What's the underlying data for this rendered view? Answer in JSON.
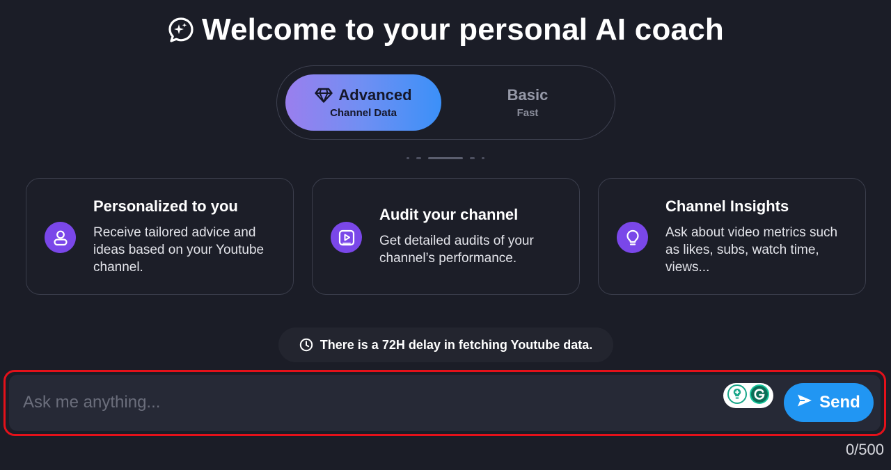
{
  "header": {
    "title": "Welcome to your personal AI coach",
    "title_icon": "chat-sparkle-icon"
  },
  "mode_toggle": {
    "advanced": {
      "label": "Advanced",
      "sublabel": "Channel Data",
      "icon": "diamond-icon",
      "selected": true
    },
    "basic": {
      "label": "Basic",
      "sublabel": "Fast",
      "selected": false
    }
  },
  "cards": [
    {
      "title": "Personalized to you",
      "text": "Receive tailored advice and ideas based on your Youtube channel.",
      "icon": "user-icon"
    },
    {
      "title": "Audit your channel",
      "text": "Get detailed audits of your channel’s performance.",
      "icon": "video-play-icon"
    },
    {
      "title": "Channel Insights",
      "text": "Ask about video metrics such as likes, subs, watch time, views...",
      "icon": "lightbulb-icon"
    }
  ],
  "notice": {
    "text": "There is a 72H delay in fetching Youtube data.",
    "icon": "clock-icon"
  },
  "chat": {
    "placeholder": "Ask me anything...",
    "value": "",
    "send_label": "Send",
    "counter": "0/500"
  },
  "colors": {
    "background": "#1b1d27",
    "accent_purple": "#7a47e9",
    "send_blue": "#2196f3",
    "highlight_red": "#e4111a"
  }
}
